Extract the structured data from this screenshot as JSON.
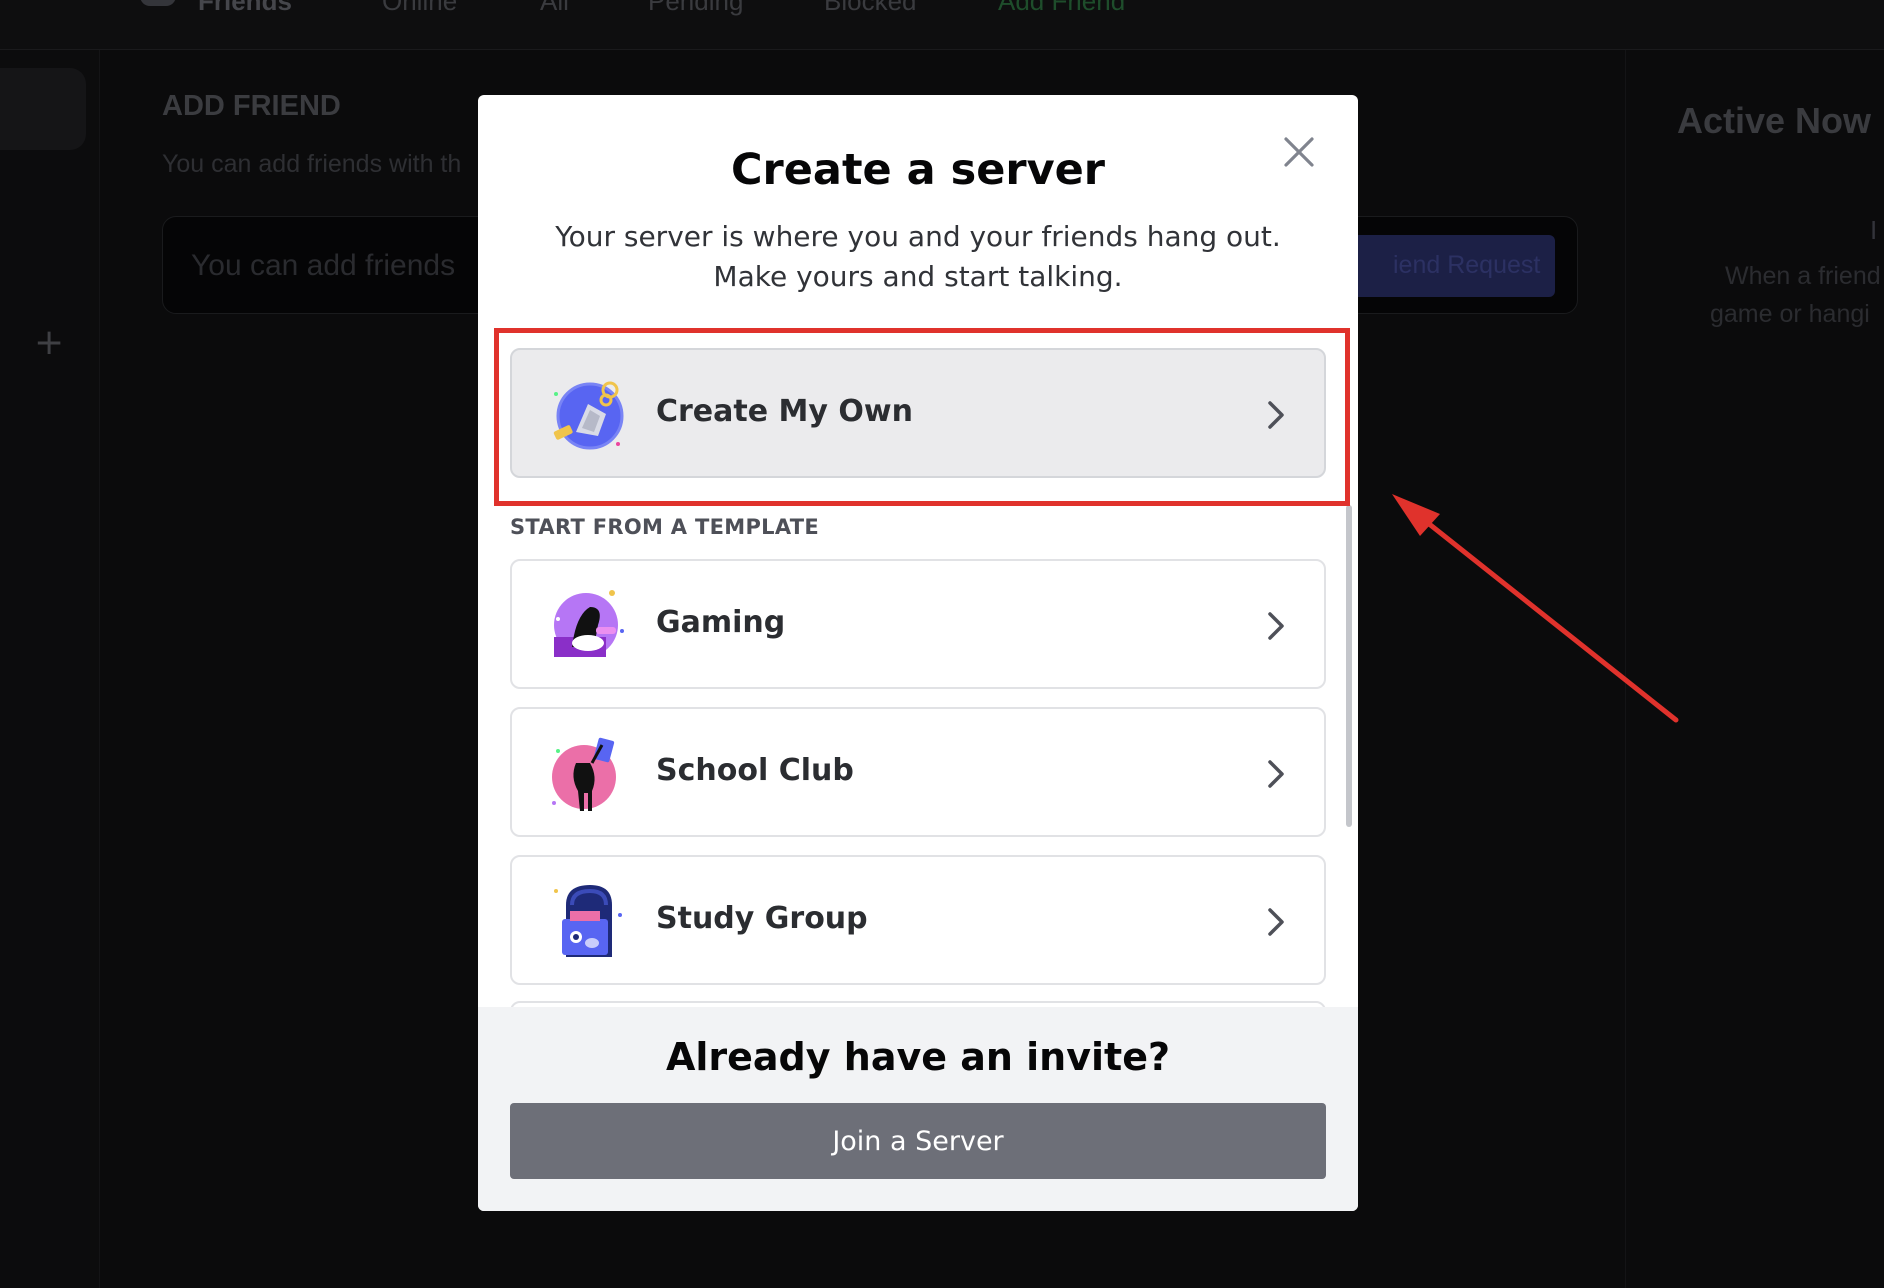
{
  "background": {
    "tabs": [
      "Friends",
      "Online",
      "All",
      "Pending",
      "Blocked",
      "Add Friend"
    ],
    "section_title": "ADD FRIEND",
    "section_subtitle": "You can add friends with th",
    "search_placeholder": "You can add friends",
    "send_button": "iend Request",
    "active_now_title": "Active Now",
    "active_now_line1": "I",
    "active_now_line2": "When a friend",
    "active_now_line3": "game or hangi"
  },
  "modal": {
    "title": "Create a server",
    "description": "Your server is where you and your friends hang out. Make yours and start talking.",
    "close_icon": "close-icon",
    "primary_option": {
      "label": "Create My Own",
      "icon": "create-server-icon"
    },
    "section_header": "START FROM A TEMPLATE",
    "templates": [
      {
        "label": "Gaming",
        "icon": "gaming-icon"
      },
      {
        "label": "School Club",
        "icon": "school-club-icon"
      },
      {
        "label": "Study Group",
        "icon": "study-group-icon"
      }
    ],
    "footer": {
      "title": "Already have an invite?",
      "join_button": "Join a Server"
    }
  },
  "annotation": {
    "highlight_color": "#e0322c"
  }
}
